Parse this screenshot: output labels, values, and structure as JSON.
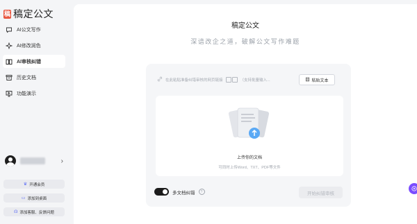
{
  "app": {
    "logo_mark": "稿",
    "logo_text": "稿定公文"
  },
  "sidebar": {
    "items": [
      {
        "label": "AI公文写作",
        "icon": "chat-icon",
        "active": false
      },
      {
        "label": "AI修改润色",
        "icon": "sparkle-icon",
        "active": false
      },
      {
        "label": "AI审核纠错",
        "icon": "book-icon",
        "active": true
      },
      {
        "label": "历史文档",
        "icon": "archive-icon",
        "active": false
      },
      {
        "label": "功能演示",
        "icon": "presentation-icon",
        "active": false
      }
    ],
    "user_chevron": "›",
    "buttons": [
      {
        "label": "开通会员",
        "icon": "crown-icon"
      },
      {
        "label": "添加到桌面",
        "icon": "monitor-icon"
      },
      {
        "label": "添加客服、反馈问题",
        "icon": "headset-icon"
      }
    ]
  },
  "main": {
    "title": "稿定公文",
    "subtitle": "深谙改企之道，破解公文写作难题",
    "link_placeholder": "在此粘贴准备纠错审核的网页链接",
    "link_hint": "（支持批量输入...",
    "paste_button": "粘贴文本",
    "upload_title": "上传你的文档",
    "upload_hint": "可同时上传Word、TXT、PDF等文件",
    "multi_doc_label": "多文档纠错",
    "start_button": "开始纠错审核"
  }
}
